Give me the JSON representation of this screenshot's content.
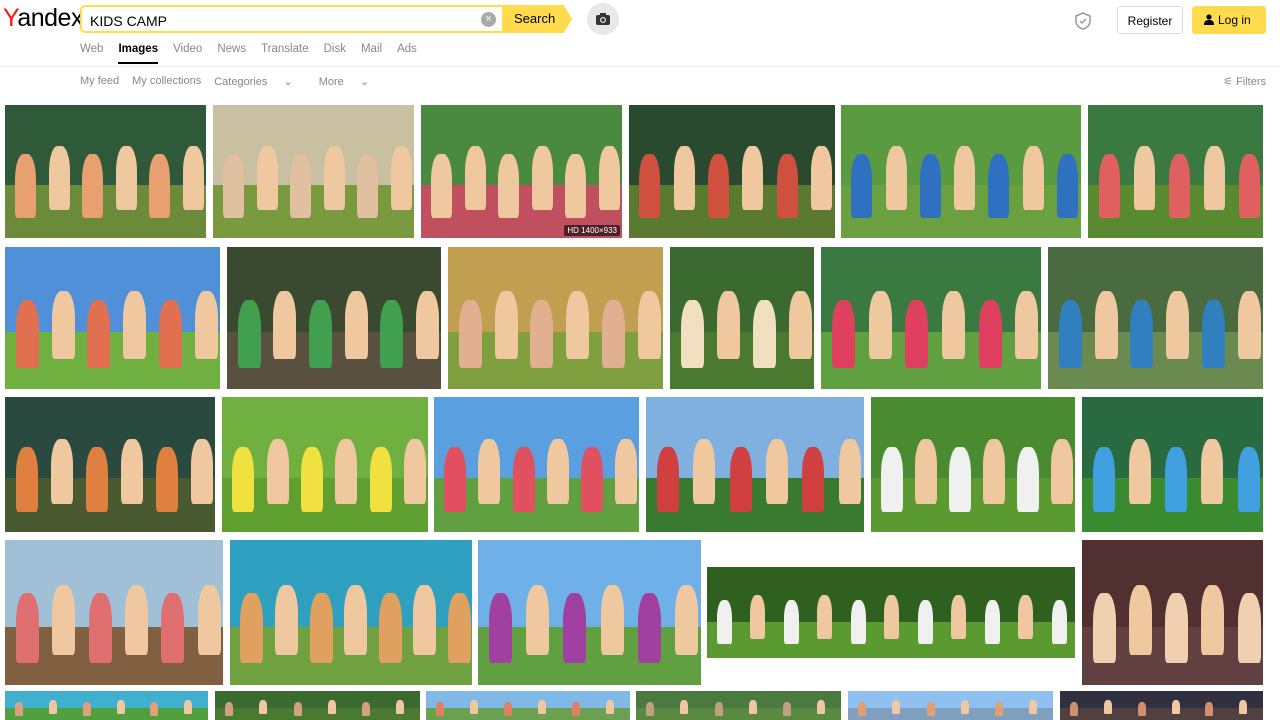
{
  "brand": {
    "logo_first": "Y",
    "logo_rest": "andex"
  },
  "search": {
    "query": "KIDS CAMP",
    "button_label": "Search"
  },
  "services": [
    {
      "label": "Web",
      "active": false
    },
    {
      "label": "Images",
      "active": true
    },
    {
      "label": "Video",
      "active": false
    },
    {
      "label": "News",
      "active": false
    },
    {
      "label": "Translate",
      "active": false
    },
    {
      "label": "Disk",
      "active": false
    },
    {
      "label": "Mail",
      "active": false
    },
    {
      "label": "Ads",
      "active": false
    }
  ],
  "header": {
    "register_label": "Register",
    "login_label": "Log in"
  },
  "subnav": {
    "my_feed": "My feed",
    "my_collections": "My collections",
    "categories": "Categories",
    "more": "More",
    "filters": "Filters"
  },
  "results": {
    "hd_badge": "HD 1400×933",
    "tiles": [
      {
        "sky": "#2e5a3a",
        "ground": "#6b8a3a",
        "figs": "#e8a070"
      },
      {
        "sky": "#c8c0a0",
        "ground": "#7a9a40",
        "figs": "#e0c0a0"
      },
      {
        "sky": "#4a8a40",
        "ground": "#c05060",
        "figs": "#f0c8a0"
      },
      {
        "sky": "#2a4a30",
        "ground": "#5a7a30",
        "figs": "#d05040"
      },
      {
        "sky": "#5a9a40",
        "ground": "#6aa040",
        "figs": "#3070c0"
      },
      {
        "sky": "#3a7a40",
        "ground": "#5a8a30",
        "figs": "#e06060"
      },
      {
        "sky": "#5090d8",
        "ground": "#70b040",
        "figs": "#e07050"
      },
      {
        "sky": "#3a4a30",
        "ground": "#5a5040",
        "figs": "#40a050"
      },
      {
        "sky": "#c0a050",
        "ground": "#80a040",
        "figs": "#e0b090"
      },
      {
        "sky": "#3a6a30",
        "ground": "#4a7a30",
        "figs": "#f0e0c0"
      },
      {
        "sky": "#3a7a40",
        "ground": "#60a040",
        "figs": "#e04060"
      },
      {
        "sky": "#4a6a40",
        "ground": "#6a8a50",
        "figs": "#3080c0"
      },
      {
        "sky": "#2a4a40",
        "ground": "#4a5a30",
        "figs": "#e08040"
      },
      {
        "sky": "#70b040",
        "ground": "#60a030",
        "figs": "#f0e040"
      },
      {
        "sky": "#5aa0e0",
        "ground": "#60a040",
        "figs": "#e05060"
      },
      {
        "sky": "#80b0e0",
        "ground": "#3a7a30",
        "figs": "#d04040"
      },
      {
        "sky": "#4a8a30",
        "ground": "#5a9a30",
        "figs": "#f0f0f0"
      },
      {
        "sky": "#2a6a40",
        "ground": "#3a8a30",
        "figs": "#40a0e0"
      },
      {
        "sky": "#a0c0d8",
        "ground": "#806040",
        "figs": "#e07070"
      },
      {
        "sky": "#30a0c0",
        "ground": "#70a040",
        "figs": "#e0a060"
      },
      {
        "sky": "#70b0e8",
        "ground": "#60a040",
        "figs": "#a040a0"
      },
      {
        "sky": "#306020",
        "ground": "#5a9a30",
        "figs": "#f0f0f0"
      },
      {
        "sky": "#503030",
        "ground": "#604040",
        "figs": "#f0d0b0"
      },
      {
        "sky": "#40b0d0",
        "ground": "#50a040",
        "figs": "#e0a080"
      },
      {
        "sky": "#3a6a30",
        "ground": "#4a7a30",
        "figs": "#d0a080"
      },
      {
        "sky": "#80b8e8",
        "ground": "#6aa050",
        "figs": "#e08060"
      },
      {
        "sky": "#4a7a40",
        "ground": "#5a8a40",
        "figs": "#c0a080"
      },
      {
        "sky": "#90c0f0",
        "ground": "#80a0c0",
        "figs": "#e0a070"
      },
      {
        "sky": "#303040",
        "ground": "#504040",
        "figs": "#d09070"
      }
    ]
  }
}
